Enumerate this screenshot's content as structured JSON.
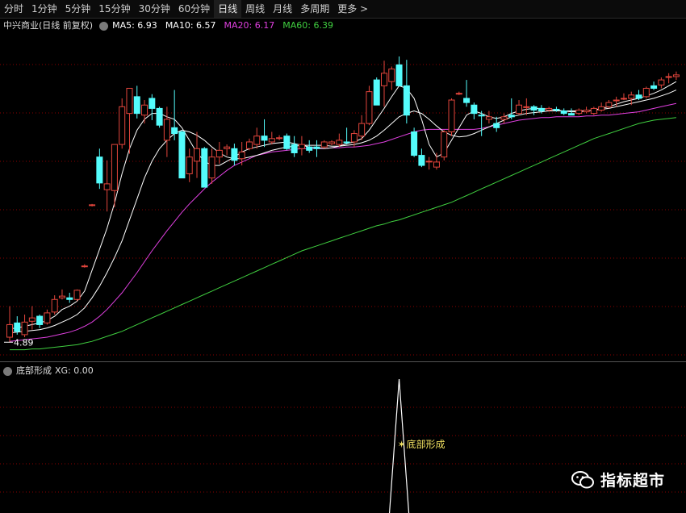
{
  "tabs": [
    "分时",
    "1分钟",
    "5分钟",
    "15分钟",
    "30分钟",
    "60分钟",
    "日线",
    "周线",
    "月线",
    "多周期",
    "更多 >"
  ],
  "active_tab": "日线",
  "main_legend": {
    "title": "中兴商业(日线 前复权)",
    "ma5": "MA5: 6.93",
    "ma10": "MA10: 6.57",
    "ma20": "MA20: 6.17",
    "ma60": "MA60: 6.39"
  },
  "low_price_label": "4.89",
  "indicator_legend": {
    "title": "底部形成",
    "value": "XG: 0.00"
  },
  "signal_label": "底部形成",
  "brand": "指标超市",
  "colors": {
    "up": "#e2453c",
    "down": "#54fcfc",
    "ma5": "#ffffff",
    "ma10": "#ffffff",
    "ma20": "#e040e0",
    "ma60": "#40d040",
    "grid": "#8b0000",
    "signal": "#ffffff",
    "signal_label": "#f0e060"
  },
  "chart_data": {
    "type": "candlestick",
    "ylim": [
      4.7,
      8.3
    ],
    "ohlc": [
      [
        4.95,
        5.32,
        4.89,
        5.1
      ],
      [
        5.12,
        5.2,
        4.98,
        5.02
      ],
      [
        4.98,
        5.22,
        4.95,
        5.13
      ],
      [
        5.14,
        5.32,
        5.04,
        5.18
      ],
      [
        5.2,
        5.22,
        5.06,
        5.1
      ],
      [
        5.12,
        5.28,
        5.1,
        5.24
      ],
      [
        5.25,
        5.45,
        5.22,
        5.4
      ],
      [
        5.42,
        5.52,
        5.4,
        5.44
      ],
      [
        5.42,
        5.48,
        5.36,
        5.4
      ],
      [
        5.4,
        5.52,
        5.38,
        5.51
      ],
      [
        5.8,
        5.82,
        5.78,
        5.8
      ],
      [
        6.53,
        6.54,
        6.51,
        6.53
      ],
      [
        7.1,
        7.2,
        6.72,
        6.79
      ],
      [
        6.71,
        7.06,
        6.45,
        6.78
      ],
      [
        6.7,
        7.05,
        6.5,
        7.25
      ],
      [
        7.25,
        7.8,
        7.2,
        7.7
      ],
      [
        7.62,
        7.92,
        7.14,
        7.92
      ],
      [
        7.82,
        7.95,
        7.56,
        7.62
      ],
      [
        7.6,
        7.78,
        7.5,
        7.72
      ],
      [
        7.8,
        7.85,
        7.54,
        7.68
      ],
      [
        7.68,
        7.7,
        7.45,
        7.48
      ],
      [
        7.3,
        7.7,
        7.1,
        7.55
      ],
      [
        7.45,
        7.9,
        7.3,
        7.38
      ],
      [
        7.4,
        7.42,
        6.86,
        6.85
      ],
      [
        6.9,
        7.2,
        6.8,
        7.1
      ],
      [
        7.05,
        7.4,
        6.85,
        7.2
      ],
      [
        7.2,
        7.22,
        6.74,
        6.74
      ],
      [
        6.85,
        7.2,
        6.78,
        7.1
      ],
      [
        7.1,
        7.28,
        7.02,
        7.18
      ],
      [
        7.2,
        7.25,
        7.12,
        7.22
      ],
      [
        7.2,
        7.26,
        7.0,
        7.06
      ],
      [
        7.08,
        7.28,
        7.0,
        7.16
      ],
      [
        7.2,
        7.32,
        7.18,
        7.28
      ],
      [
        7.25,
        7.45,
        7.2,
        7.35
      ],
      [
        7.35,
        7.55,
        7.22,
        7.3
      ],
      [
        7.28,
        7.4,
        7.25,
        7.32
      ],
      [
        7.32,
        7.36,
        7.3,
        7.33
      ],
      [
        7.35,
        7.38,
        7.18,
        7.2
      ],
      [
        7.25,
        7.35,
        7.1,
        7.15
      ],
      [
        7.2,
        7.35,
        7.12,
        7.25
      ],
      [
        7.22,
        7.3,
        7.15,
        7.18
      ],
      [
        7.22,
        7.3,
        7.1,
        7.2
      ],
      [
        7.22,
        7.3,
        7.2,
        7.28
      ],
      [
        7.26,
        7.3,
        7.24,
        7.28
      ],
      [
        7.25,
        7.38,
        7.22,
        7.3
      ],
      [
        7.28,
        7.45,
        7.25,
        7.27
      ],
      [
        7.28,
        7.42,
        7.22,
        7.38
      ],
      [
        7.35,
        7.6,
        7.3,
        7.5
      ],
      [
        7.5,
        7.95,
        7.48,
        7.88
      ],
      [
        8.02,
        8.05,
        7.72,
        7.72
      ],
      [
        7.95,
        8.25,
        7.7,
        8.1
      ],
      [
        8.0,
        8.18,
        7.9,
        8.15
      ],
      [
        8.2,
        8.3,
        7.95,
        7.95
      ],
      [
        7.95,
        8.26,
        7.5,
        7.6
      ],
      [
        7.4,
        7.45,
        7.1,
        7.12
      ],
      [
        7.12,
        7.2,
        6.98,
        7.0
      ],
      [
        7.05,
        7.1,
        6.95,
        7.05
      ],
      [
        6.98,
        7.15,
        6.95,
        7.04
      ],
      [
        7.1,
        7.42,
        7.06,
        7.4
      ],
      [
        7.4,
        7.8,
        7.35,
        7.78
      ],
      [
        7.86,
        7.88,
        7.84,
        7.86
      ],
      [
        7.8,
        8.02,
        7.7,
        7.75
      ],
      [
        7.72,
        7.75,
        7.55,
        7.62
      ],
      [
        7.6,
        7.65,
        7.35,
        7.59
      ],
      [
        7.55,
        7.65,
        7.5,
        7.58
      ],
      [
        7.5,
        7.58,
        7.4,
        7.45
      ],
      [
        7.55,
        7.62,
        7.5,
        7.58
      ],
      [
        7.6,
        7.8,
        7.55,
        7.58
      ],
      [
        7.62,
        7.78,
        7.6,
        7.72
      ],
      [
        7.7,
        7.8,
        7.6,
        7.7
      ],
      [
        7.7,
        7.72,
        7.6,
        7.66
      ],
      [
        7.68,
        7.72,
        7.62,
        7.65
      ],
      [
        7.66,
        7.7,
        7.64,
        7.68
      ],
      [
        7.67,
        7.7,
        7.64,
        7.66
      ],
      [
        7.65,
        7.68,
        7.6,
        7.62
      ],
      [
        7.62,
        7.68,
        7.6,
        7.6
      ],
      [
        7.62,
        7.68,
        7.6,
        7.66
      ],
      [
        7.64,
        7.7,
        7.62,
        7.66
      ],
      [
        7.62,
        7.7,
        7.6,
        7.68
      ],
      [
        7.66,
        7.75,
        7.64,
        7.7
      ],
      [
        7.7,
        7.78,
        7.68,
        7.75
      ],
      [
        7.78,
        7.82,
        7.7,
        7.78
      ],
      [
        7.8,
        7.86,
        7.78,
        7.8
      ],
      [
        7.8,
        7.88,
        7.72,
        7.84
      ],
      [
        7.84,
        7.9,
        7.78,
        7.8
      ],
      [
        7.82,
        7.94,
        7.8,
        7.92
      ],
      [
        7.95,
        8.0,
        7.9,
        7.92
      ],
      [
        7.96,
        8.05,
        7.92,
        8.02
      ],
      [
        8.05,
        8.1,
        7.98,
        8.06
      ],
      [
        8.06,
        8.12,
        8.02,
        8.08
      ]
    ],
    "ma5": [
      5.05,
      5.06,
      5.08,
      5.1,
      5.12,
      5.15,
      5.2,
      5.28,
      5.32,
      5.38,
      5.5,
      5.75,
      6.0,
      6.25,
      6.55,
      6.9,
      7.2,
      7.42,
      7.55,
      7.62,
      7.62,
      7.58,
      7.55,
      7.45,
      7.3,
      7.15,
      7.05,
      7.0,
      7.0,
      7.05,
      7.1,
      7.16,
      7.2,
      7.22,
      7.24,
      7.26,
      7.27,
      7.28,
      7.26,
      7.24,
      7.22,
      7.21,
      7.2,
      7.21,
      7.23,
      7.26,
      7.28,
      7.32,
      7.42,
      7.55,
      7.68,
      7.82,
      7.95,
      7.92,
      7.8,
      7.55,
      7.25,
      7.1,
      7.15,
      7.3,
      7.45,
      7.6,
      7.65,
      7.62,
      7.58,
      7.56,
      7.58,
      7.62,
      7.65,
      7.67,
      7.68,
      7.68,
      7.67,
      7.66,
      7.65,
      7.64,
      7.64,
      7.65,
      7.66,
      7.68,
      7.7,
      7.73,
      7.76,
      7.78,
      7.8,
      7.83,
      7.86,
      7.9,
      7.95,
      8.0
    ],
    "ma10": [
      5.0,
      5.01,
      5.02,
      5.03,
      5.04,
      5.06,
      5.09,
      5.13,
      5.17,
      5.22,
      5.3,
      5.42,
      5.56,
      5.72,
      5.9,
      6.1,
      6.35,
      6.6,
      6.85,
      7.05,
      7.2,
      7.3,
      7.38,
      7.42,
      7.4,
      7.36,
      7.3,
      7.22,
      7.15,
      7.1,
      7.08,
      7.08,
      7.1,
      7.12,
      7.15,
      7.18,
      7.2,
      7.22,
      7.23,
      7.24,
      7.24,
      7.24,
      7.24,
      7.23,
      7.23,
      7.24,
      7.25,
      7.27,
      7.3,
      7.35,
      7.42,
      7.5,
      7.58,
      7.62,
      7.65,
      7.62,
      7.55,
      7.47,
      7.4,
      7.36,
      7.34,
      7.35,
      7.38,
      7.42,
      7.46,
      7.5,
      7.54,
      7.58,
      7.6,
      7.62,
      7.63,
      7.64,
      7.65,
      7.65,
      7.65,
      7.65,
      7.65,
      7.65,
      7.66,
      7.67,
      7.68,
      7.7,
      7.72,
      7.74,
      7.76,
      7.78,
      7.8,
      7.83,
      7.86,
      7.9
    ],
    "ma20": [
      4.9,
      4.91,
      4.92,
      4.93,
      4.94,
      4.95,
      4.97,
      4.99,
      5.01,
      5.04,
      5.08,
      5.13,
      5.2,
      5.28,
      5.38,
      5.48,
      5.6,
      5.72,
      5.85,
      5.98,
      6.1,
      6.22,
      6.33,
      6.44,
      6.54,
      6.63,
      6.72,
      6.8,
      6.87,
      6.94,
      7.0,
      7.04,
      7.08,
      7.12,
      7.14,
      7.16,
      7.17,
      7.18,
      7.19,
      7.2,
      7.2,
      7.2,
      7.2,
      7.21,
      7.21,
      7.22,
      7.22,
      7.23,
      7.24,
      7.26,
      7.28,
      7.31,
      7.34,
      7.37,
      7.4,
      7.42,
      7.43,
      7.43,
      7.43,
      7.43,
      7.43,
      7.43,
      7.43,
      7.44,
      7.46,
      7.48,
      7.5,
      7.52,
      7.54,
      7.55,
      7.56,
      7.57,
      7.57,
      7.58,
      7.58,
      7.58,
      7.58,
      7.59,
      7.59,
      7.6,
      7.6,
      7.61,
      7.62,
      7.63,
      7.64,
      7.66,
      7.68,
      7.7,
      7.72,
      7.74
    ],
    "ma60": [
      4.8,
      4.8,
      4.8,
      4.81,
      4.81,
      4.82,
      4.83,
      4.84,
      4.85,
      4.86,
      4.88,
      4.9,
      4.93,
      4.96,
      4.99,
      5.02,
      5.06,
      5.1,
      5.14,
      5.18,
      5.22,
      5.26,
      5.3,
      5.34,
      5.38,
      5.42,
      5.46,
      5.5,
      5.54,
      5.58,
      5.62,
      5.66,
      5.7,
      5.74,
      5.78,
      5.82,
      5.86,
      5.9,
      5.94,
      5.98,
      6.01,
      6.04,
      6.07,
      6.1,
      6.13,
      6.16,
      6.19,
      6.22,
      6.25,
      6.28,
      6.3,
      6.33,
      6.35,
      6.38,
      6.41,
      6.44,
      6.47,
      6.5,
      6.53,
      6.56,
      6.6,
      6.64,
      6.68,
      6.72,
      6.76,
      6.8,
      6.84,
      6.88,
      6.92,
      6.96,
      7.0,
      7.04,
      7.08,
      7.12,
      7.16,
      7.2,
      7.24,
      7.28,
      7.32,
      7.35,
      7.38,
      7.41,
      7.44,
      7.47,
      7.5,
      7.52,
      7.54,
      7.55,
      7.56,
      7.57
    ],
    "xg": [
      0,
      0,
      0,
      0,
      0,
      0,
      0,
      0,
      0,
      0,
      0,
      0,
      0,
      0,
      0,
      0,
      0,
      0,
      0,
      0,
      0,
      0,
      0,
      0,
      0,
      0,
      0,
      0,
      0,
      0,
      0,
      0,
      0,
      0,
      0,
      0,
      0,
      0,
      0,
      0,
      0,
      0,
      0,
      0,
      0,
      0,
      0,
      0,
      0,
      0,
      0,
      0,
      0,
      0,
      0,
      0,
      0,
      0,
      0,
      0,
      0,
      0,
      0,
      0,
      0,
      0,
      0,
      0,
      0,
      0,
      0,
      0,
      0,
      0,
      0,
      0,
      0,
      0,
      0,
      0,
      0,
      0,
      0,
      0,
      0,
      0,
      0,
      0,
      0,
      0
    ],
    "signal_index": 52
  }
}
